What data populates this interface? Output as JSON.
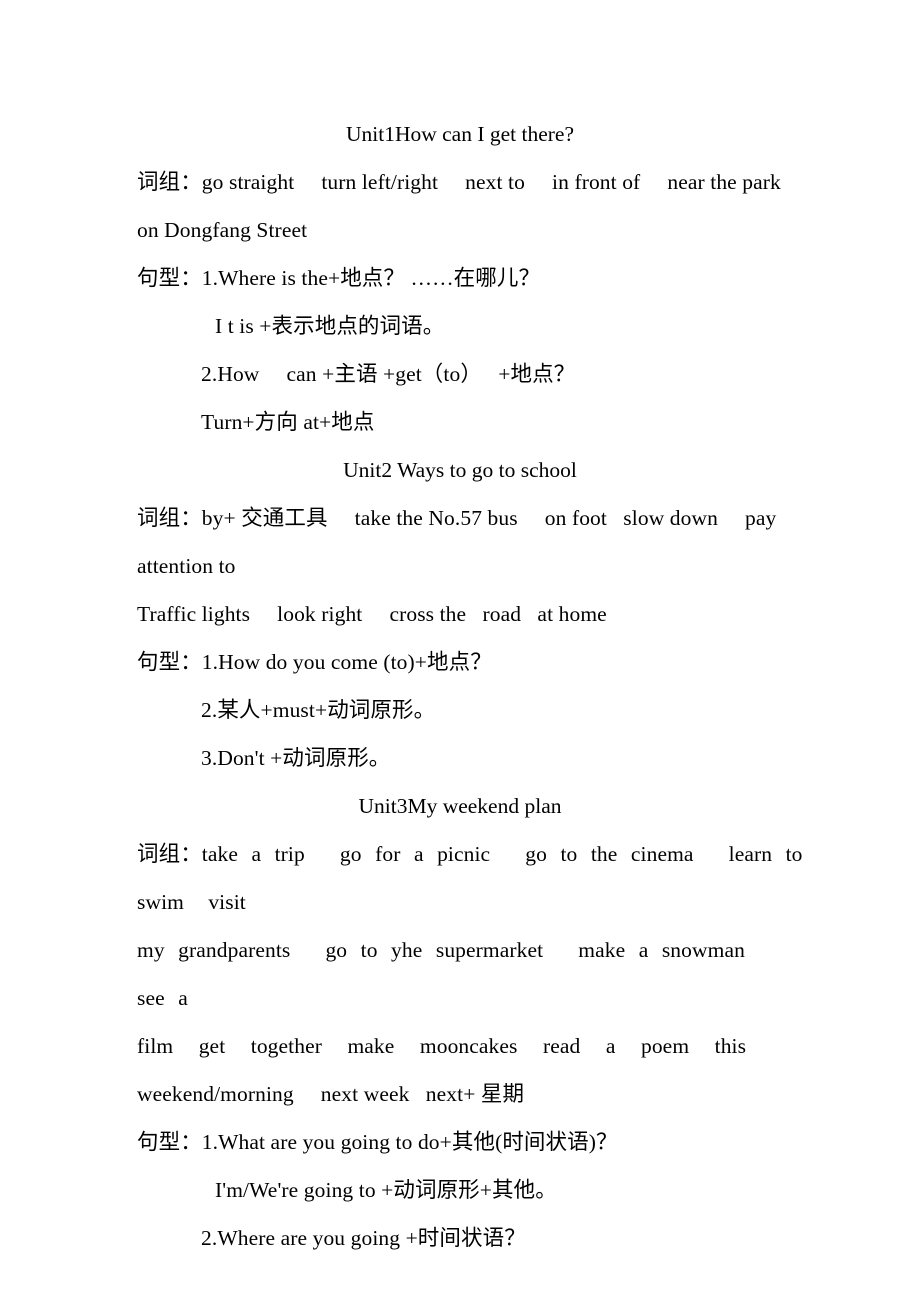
{
  "document": {
    "type": "study-notes",
    "language": "en-zh",
    "background_color": "#ffffff",
    "text_color": "#000000",
    "units": [
      {
        "heading": "Unit1How can I get there?",
        "phrases_line_1": "词组：go straight  turn left/right  next to  in front of  near the park",
        "phrases_line_2": "on Dongfang Street",
        "patterns": [
          "句型：1.Where is the+地点？ ……在哪儿？",
          "I t is +表示地点的词语。",
          "2.How  can +主语 +get（to）  +地点？",
          "Turn+方向 at+地点"
        ]
      },
      {
        "heading": "Unit2 Ways to go to school",
        "phrases_line_1": "词组：by+ 交通工具  take the No.57 bus  on foot  slow down  pay",
        "phrases_line_2": "attention to",
        "phrases_line_3": "Traffic lights  look right  cross the  road  at home",
        "patterns": [
          "句型：1.How do you come (to)+地点？",
          "2.某人+must+动词原形。",
          "3.Don't +动词原形。"
        ]
      },
      {
        "heading": "Unit3My weekend plan",
        "phrases_line_1": "词组：take a trip  go for a picnic  go to the cinema  learn to swim  visit",
        "phrases_line_2": "my grandparents  go to yhe supermarket  make a snowman  see a",
        "phrases_line_3": "film get together make mooncakes read a poem this",
        "phrases_line_4": "weekend/morning  next week  next+ 星期",
        "patterns": [
          "句型：1.What are you going to do+其他(时间状语)？",
          "I'm/We're going to +动词原形+其他。",
          "2.Where are you going +时间状语？"
        ]
      }
    ]
  }
}
